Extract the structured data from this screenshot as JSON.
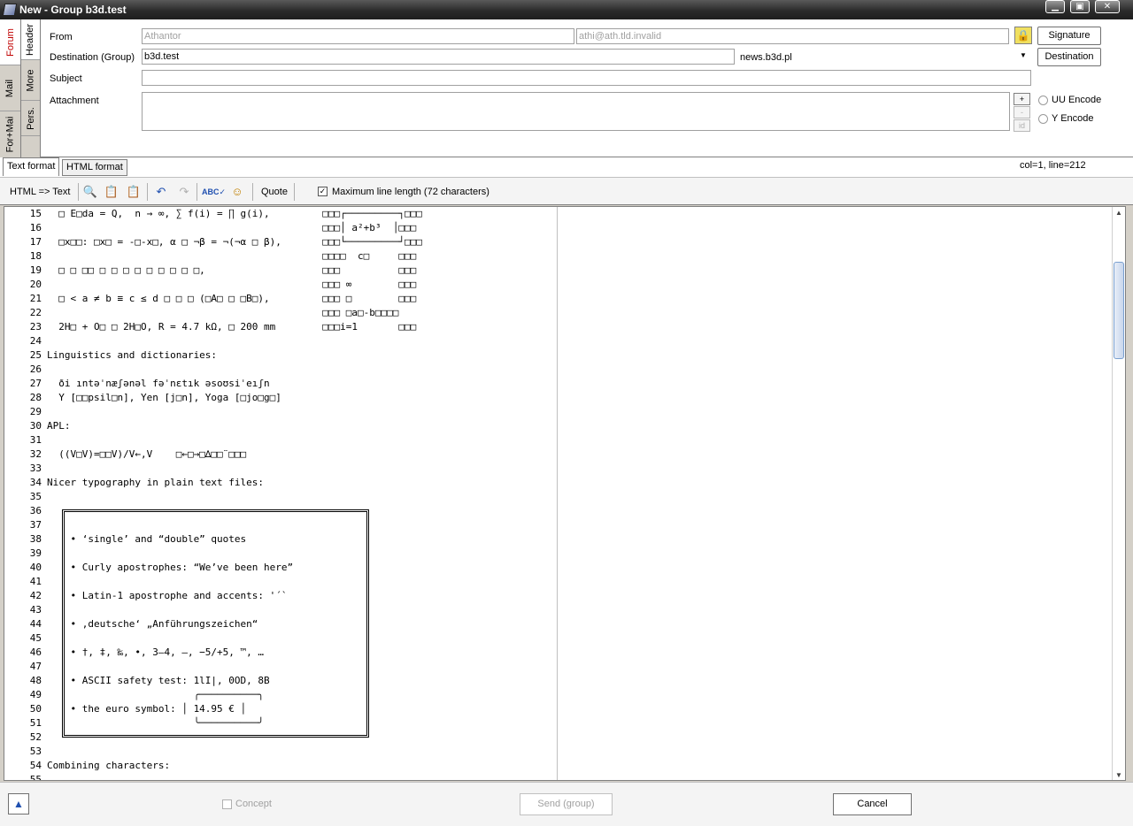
{
  "window": {
    "title": "New - Group b3d.test"
  },
  "left_tabs": [
    "Forum",
    "Mail",
    "For+Mai"
  ],
  "right_tabs": [
    "Header",
    "More",
    "Pers."
  ],
  "header_form": {
    "from_label": "From",
    "from_name": "Athantor",
    "from_email": "athi@ath.tld.invalid",
    "signature_button": "Signature",
    "destination_label": "Destination (Group)",
    "destination_value": "b3d.test",
    "server_value": "news.b3d.pl",
    "destination_button": "Destination",
    "subject_label": "Subject",
    "subject_value": "",
    "attachment_label": "Attachment",
    "attach_add": "+",
    "attach_remove": "-",
    "attach_id": "id",
    "uu_encode": "UU Encode",
    "y_encode": "Y Encode"
  },
  "format_tabs": {
    "text": "Text format",
    "html": "HTML format"
  },
  "cursor_status": "col=1, line=212",
  "toolbar": {
    "html_to_text": "HTML => Text",
    "quote": "Quote",
    "max_line_label": "Maximum line length (72 characters)",
    "max_line_checked": "✓"
  },
  "editor": {
    "line_numbers": [
      "15",
      "16",
      "17",
      "18",
      "19",
      "20",
      "21",
      "22",
      "23",
      "24",
      "25",
      "26",
      "27",
      "28",
      "29",
      "30",
      "31",
      "32",
      "33",
      "34",
      "35",
      "36",
      "37",
      "38",
      "39",
      "40",
      "41",
      "42",
      "43",
      "44",
      "45",
      "46",
      "47",
      "48",
      "49",
      "50",
      "51",
      "52",
      "53",
      "54",
      "55"
    ],
    "lines": [
      "  □ E□da = Q,  n → ∞, ∑ f(i) = ∏ g(i),         □□□┌─────────┐□□□",
      "                                               □□□│ a²+b³  │□□□",
      "  □x□□: □x□ = -□-x□, α □ ¬β = ¬(¬α □ β),       □□□└─────────┘□□□",
      "                                               □□□□  c□     □□□",
      "  □ □ □□ □ □ □ □ □ □ □ □ □,                    □□□          □□□",
      "                                               □□□ ∞        □□□",
      "  □ < a ≠ b ≡ c ≤ d □ □ □ (□A□ □ □B□),         □□□ □        □□□",
      "                                               □□□ □a□-b□□□□",
      "  2H□ + O□ □ 2H□O, R = 4.7 kΩ, □ 200 mm        □□□i=1       □□□",
      "",
      "Linguistics and dictionaries:",
      "",
      "  ði ıntəˈnæʃənəl fəˈnɛtık əsoʊsiˈeıʃn",
      "  Y [□□psil□n], Yen [j□n], Yoga [□jo□g□]",
      "",
      "APL:",
      "",
      "  ((V□V)=□□V)/V←,V    □←□→□∆□□¨□□□",
      "",
      "Nicer typography in plain text files:",
      "",
      "",
      "",
      "    • ‘single’ and “double” quotes",
      "",
      "    • Curly apostrophes: “We’ve been here”",
      "",
      "    • Latin-1 apostrophe and accents: '´`",
      "",
      "    • ‚deutsche‘ „Anführungszeichen“",
      "",
      "    • †, ‡, ‰, •, 3–4, —, −5/+5, ™, …",
      "",
      "    • ASCII safety test: 1lI|, 0OD, 8B",
      "                         ╭──────────╮",
      "    • the euro symbol: │ 14.95 € │",
      "                         ╰──────────╯",
      "",
      "",
      "Combining characters:",
      ""
    ]
  },
  "statusbar": {
    "concept": "Concept",
    "send": "Send (group)",
    "cancel": "Cancel"
  }
}
